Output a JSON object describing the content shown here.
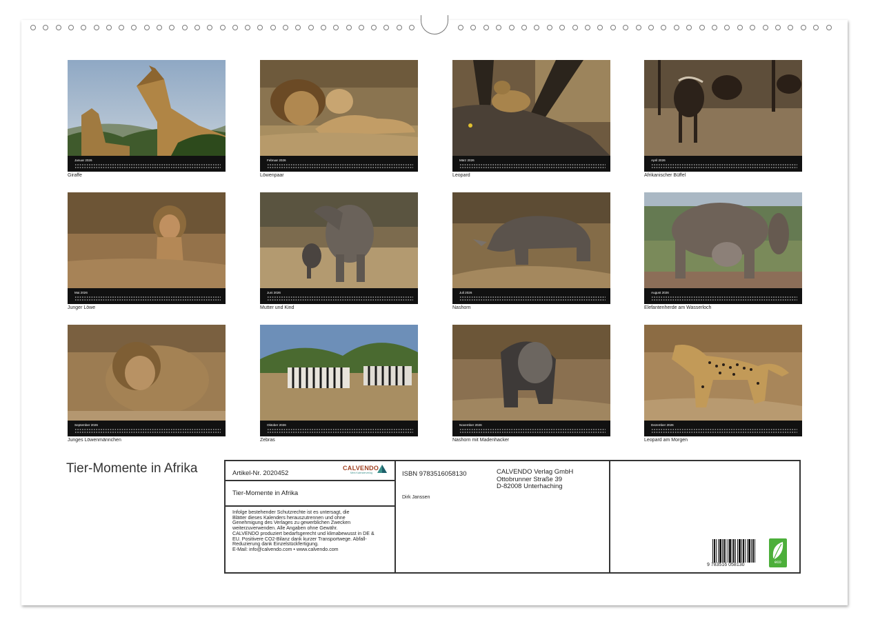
{
  "calendar": {
    "title": "Tier-Momente in Afrika",
    "months": [
      {
        "label": "Januar 2026",
        "caption": "Giraffe"
      },
      {
        "label": "Februar 2026",
        "caption": "Löwenpaar"
      },
      {
        "label": "März 2026",
        "caption": "Leopard"
      },
      {
        "label": "April 2026",
        "caption": "Afrikanischer Büffel"
      },
      {
        "label": "Mai 2026",
        "caption": "Junger Löwe"
      },
      {
        "label": "Juni 2026",
        "caption": "Mutter und Kind"
      },
      {
        "label": "Juli 2026",
        "caption": "Nashorn"
      },
      {
        "label": "August 2026",
        "caption": "Elefantenherde am Wasserloch"
      },
      {
        "label": "September 2026",
        "caption": "Junges Löwenmännchen"
      },
      {
        "label": "Oktober 2026",
        "caption": "Zebras"
      },
      {
        "label": "November 2026",
        "caption": "Nashorn mit Madenhacker"
      },
      {
        "label": "Dezember 2026",
        "caption": "Leopard am Morgen"
      }
    ]
  },
  "info": {
    "article": "Artikel-Nr. 2020452",
    "brand": "CALVENDO",
    "brand_sub": "Mein Kalenderverlag",
    "product_title": "Tier-Momente in Afrika",
    "legal": [
      "Infolge bestehender Schutzrechte ist es untersagt, die",
      "Blätter dieses Kalenders herauszutrennen und ohne",
      "Genehmigung des Verlages zu gewerblichen Zwecken",
      "weiterzuverwenden. Alle Angaben ohne Gewähr.",
      "CALVENDO produziert bedarfsgerecht und klimabewusst in DE &",
      "EU. Positivere CO2-Bilanz dank kurzer Transportwege. Abfall-",
      "Reduzierung dank Einzelstückfertigung.",
      "E-Mail: info@calvendo.com • www.calvendo.com"
    ],
    "isbn": "ISBN 9783516058130",
    "author": "Dirk Janssen",
    "publisher_lines": [
      "CALVENDO Verlag GmbH",
      "Ottobrunner Straße 39",
      "D-82008 Unterhaching"
    ],
    "barcode_digits": "9 783516 058130",
    "eco_label": "eco"
  }
}
